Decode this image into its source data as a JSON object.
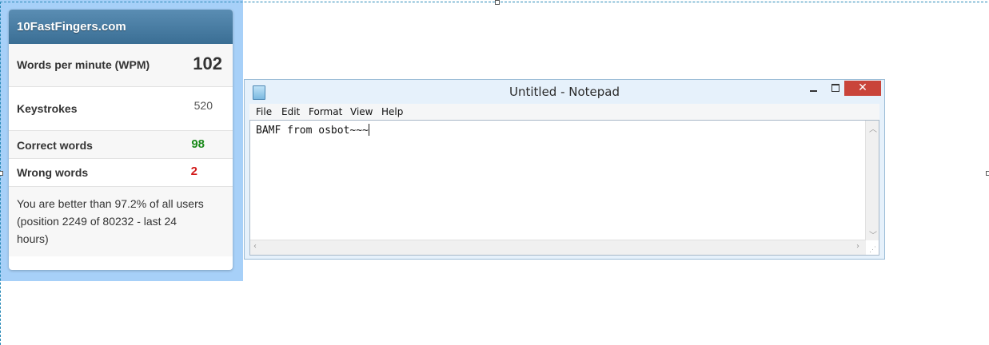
{
  "widget": {
    "brand": "10FastFingers.com",
    "rows": [
      {
        "label": "Words per minute (WPM)",
        "value": "102"
      },
      {
        "label": "Keystrokes",
        "value": "520"
      },
      {
        "label": "Correct words",
        "value": "98"
      },
      {
        "label": "Wrong words",
        "value": "2"
      }
    ],
    "note_line1": "You are better than 97.2% of all users",
    "note_line2": "(position 2249 of 80232 - last 24",
    "note_line3": "hours)",
    "colors": {
      "header": "#3a6e94",
      "correct": "#1a8a1a",
      "wrong": "#d21a1a",
      "highlight": "#a7d0f8"
    }
  },
  "notepad": {
    "title": "Untitled - Notepad",
    "menu": [
      "File",
      "Edit",
      "Format",
      "View",
      "Help"
    ],
    "content": "BAMF from osbot~~~",
    "close_glyph": "✕",
    "icon": "notepad-icon"
  }
}
